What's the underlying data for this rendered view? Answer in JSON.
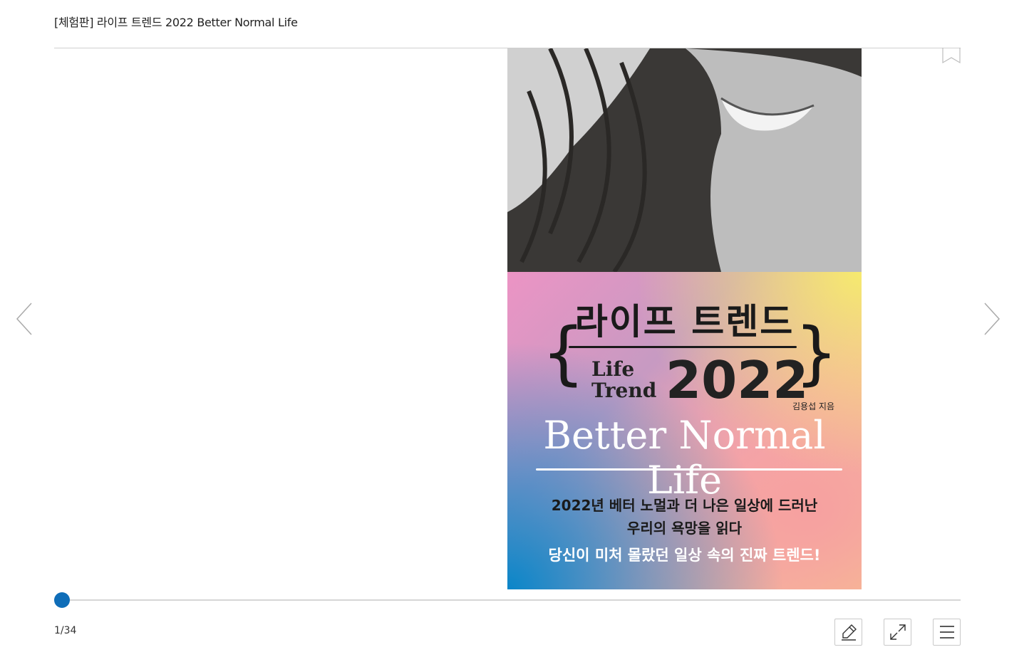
{
  "header": {
    "title": "[체험판] 라이프 트렌드 2022 Better Normal Life"
  },
  "book": {
    "cover_title": "라이프 트렌드",
    "cover_lifetrend": "Life Trend",
    "cover_year": "2022",
    "cover_author": "김용섭 지음",
    "cover_subtitle": "Better Normal Life",
    "cover_line1": "2022년 베터 노멀과 더 나은 일상에 드러난",
    "cover_line2": "우리의 욕망을 읽다",
    "cover_line3": "당신이 미처 몰랐던 일상 속의 진짜 트렌드!"
  },
  "progress": {
    "current_page": 1,
    "total_pages": 34,
    "label": "1/34"
  },
  "icons": {
    "bookmark": "bookmark-icon",
    "prev": "chevron-left-icon",
    "next": "chevron-right-icon",
    "pen": "pen-icon",
    "expand": "expand-icon",
    "menu": "menu-icon"
  },
  "colors": {
    "accent": "#0f6db8",
    "border": "#c9c9c9",
    "rule": "#cfcfcf"
  }
}
